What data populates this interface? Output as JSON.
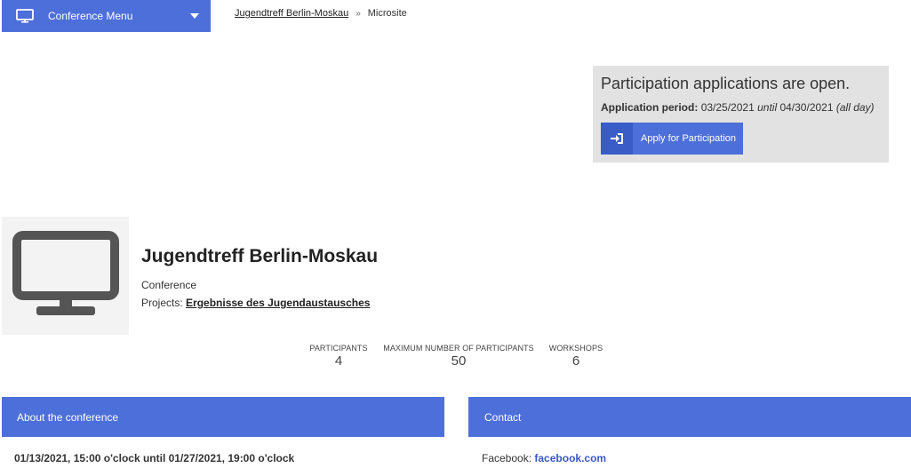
{
  "menu": {
    "label": "Conference Menu",
    "icon": "monitor-icon"
  },
  "breadcrumb": {
    "link": "Jugendtreff Berlin-Moskau",
    "separator": "»",
    "current": "Microsite"
  },
  "application": {
    "headline": "Participation applications are open.",
    "period_label": "Application period:",
    "period_start": "03/25/2021",
    "until_word": "until",
    "period_end": "04/30/2021",
    "all_day": "(all day)",
    "button_label": "Apply for Participation"
  },
  "profile": {
    "title": "Jugendtreff Berlin-Moskau",
    "type": "Conference",
    "projects_label": "Projects:",
    "projects_link": "Ergebnisse des Jugendaustausches"
  },
  "stats": [
    {
      "label": "PARTICIPANTS",
      "value": "4"
    },
    {
      "label": "MAXIMUM NUMBER OF PARTICIPANTS",
      "value": "50"
    },
    {
      "label": "WORKSHOPS",
      "value": "6"
    }
  ],
  "about": {
    "heading": "About the conference",
    "dates": "01/13/2021, 15:00 o'clock until 01/27/2021, 19:00 o'clock"
  },
  "contact": {
    "heading": "Contact",
    "facebook_label": "Facebook:",
    "facebook_link": "facebook.com"
  },
  "colors": {
    "accent": "#4d6fd9",
    "panel_bg": "#e2e2e2",
    "link": "#3b57c4"
  }
}
